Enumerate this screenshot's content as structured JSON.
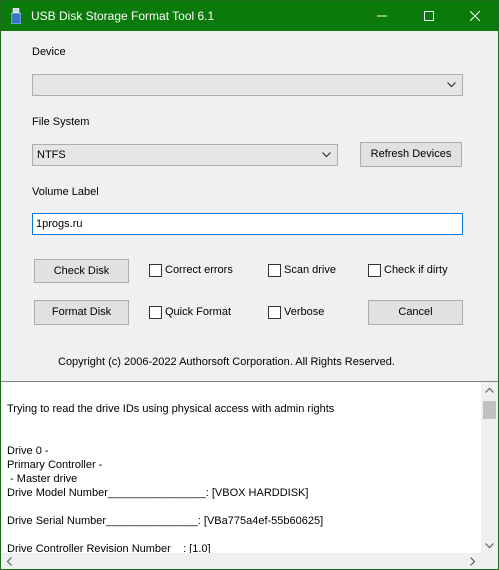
{
  "window": {
    "title": "USB Disk Storage Format Tool 6.1",
    "accent_color": "#0a7a0a"
  },
  "device": {
    "label": "Device",
    "selected": ""
  },
  "file_system": {
    "label": "File System",
    "selected": "NTFS"
  },
  "buttons": {
    "refresh_devices": "Refresh Devices",
    "check_disk": "Check Disk",
    "format_disk": "Format Disk",
    "cancel": "Cancel"
  },
  "volume_label": {
    "label": "Volume Label",
    "value": "1progs.ru"
  },
  "options": {
    "correct_errors": {
      "label": "Correct errors",
      "checked": false
    },
    "scan_drive": {
      "label": "Scan drive",
      "checked": false
    },
    "check_if_dirty": {
      "label": "Check if dirty",
      "checked": false
    },
    "quick_format": {
      "label": "Quick Format",
      "checked": false
    },
    "verbose": {
      "label": "Verbose",
      "checked": false
    }
  },
  "copyright": "Copyright (c) 2006-2022 Authorsoft Corporation. All Rights Reserved.",
  "log": {
    "text": "\nTrying to read the drive IDs using physical access with admin rights\n\n\nDrive 0 -\nPrimary Controller -\n - Master drive\nDrive Model Number________________: [VBOX HARDDISK]\n\nDrive Serial Number_______________: [VBa775a4ef-55b60625]\n\nDrive Controller Revision Number__: [1.0]"
  }
}
